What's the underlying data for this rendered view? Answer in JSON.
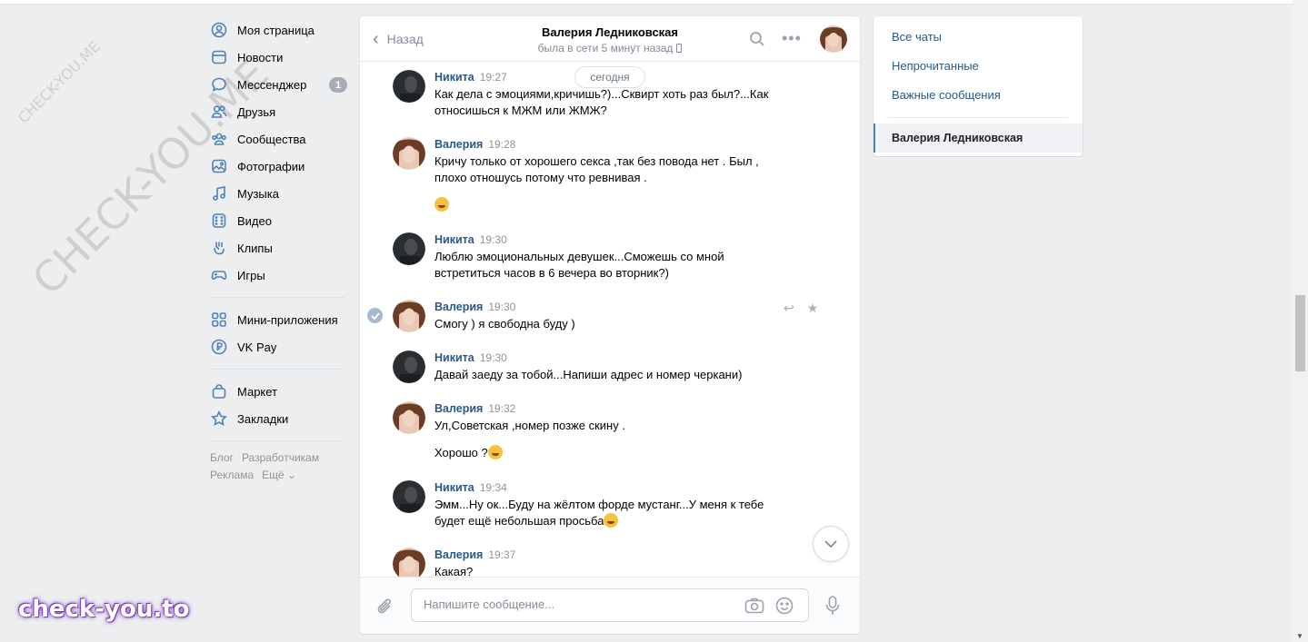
{
  "watermarks": {
    "small": "CHECK-YOU.ME",
    "large": "CHECK-YOU.ME",
    "bottom": "check-you.to"
  },
  "nav": {
    "items": [
      {
        "label": "Моя страница",
        "icon": "user-circle-icon"
      },
      {
        "label": "Новости",
        "icon": "news-icon"
      },
      {
        "label": "Мессенджер",
        "icon": "message-icon",
        "badge": "1"
      },
      {
        "label": "Друзья",
        "icon": "friends-icon"
      },
      {
        "label": "Сообщества",
        "icon": "communities-icon"
      },
      {
        "label": "Фотографии",
        "icon": "photo-icon"
      },
      {
        "label": "Музыка",
        "icon": "music-icon"
      },
      {
        "label": "Видео",
        "icon": "video-icon"
      },
      {
        "label": "Клипы",
        "icon": "clips-icon"
      },
      {
        "label": "Игры",
        "icon": "gamepad-icon"
      }
    ],
    "items2": [
      {
        "label": "Мини-приложения",
        "icon": "apps-icon"
      },
      {
        "label": "VK Pay",
        "icon": "vkpay-icon"
      }
    ],
    "items3": [
      {
        "label": "Маркет",
        "icon": "bag-icon"
      },
      {
        "label": "Закладки",
        "icon": "star-icon"
      }
    ],
    "footer": {
      "blog": "Блог",
      "developers": "Разработчикам",
      "ads": "Реклама",
      "more": "Ещё ⌄"
    }
  },
  "chat": {
    "back_label": "Назад",
    "name": "Валерия Ледниковская",
    "status": "была в сети 5 минут назад",
    "date_pill": "сегодня",
    "messages": [
      {
        "author": "Никита",
        "time": "19:27",
        "lines": [
          "Как дела с эмоциями,кричишь?)...Сквирт хоть раз был?...Как",
          "относишься к МЖМ или ЖМЖ?"
        ]
      },
      {
        "author": "Валерия",
        "time": "19:28",
        "lines": [
          "Кричу только от хорошего секса ,так без повода нет . Был ,",
          "плохо отношусь потому что ревнивая ."
        ],
        "emoji": "laughing-emoji-icon"
      },
      {
        "author": "Никита",
        "time": "19:30",
        "lines": [
          "Люблю эмоциональных девушек...Сможешь со мной",
          "встретиться часов в 6 вечера во вторник?)"
        ]
      },
      {
        "author": "Валерия",
        "time": "19:30",
        "lines": [
          "Смогу ) я свободна буду )"
        ]
      },
      {
        "author": "Никита",
        "time": "19:30",
        "lines": [
          "Давай заеду за тобой...Напиши адрес и номер черкани)"
        ]
      },
      {
        "author": "Валерия",
        "time": "19:32",
        "lines": [
          "Ул,Советская ,номер позже скину ."
        ],
        "extra": "Хорошо ?"
      },
      {
        "author": "Никита",
        "time": "19:34",
        "lines": [
          "Эмм...Ну ок...Буду на жёлтом форде мустанг...У меня к тебе",
          "будет ещё небольшая просьба"
        ]
      },
      {
        "author": "Валерия",
        "time": "19:37",
        "lines": [
          "Какая?"
        ]
      }
    ],
    "input_placeholder": "Напишите сообщение..."
  },
  "right": {
    "all_chats": "Все чаты",
    "unread": "Непрочитанные",
    "important": "Важные сообщения",
    "active_chat": "Валерия Ледниковская"
  },
  "colors": {
    "accent": "#5181b8",
    "link": "#2a5885",
    "background": "#edeef0"
  }
}
